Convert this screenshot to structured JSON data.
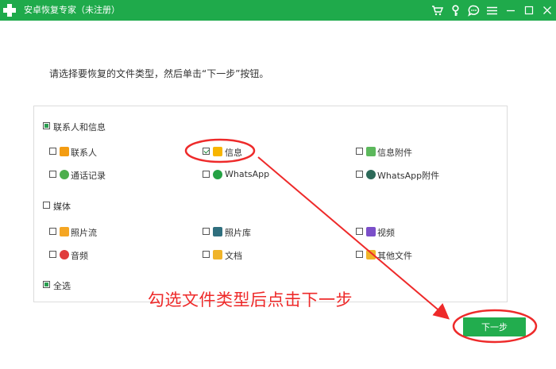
{
  "window": {
    "title": "安卓恢复专家（未注册）",
    "controls": [
      "cart-icon",
      "key-icon",
      "chat-icon",
      "menu-icon",
      "minimize-icon",
      "maximize-icon",
      "close-icon"
    ]
  },
  "instruction": "请选择要恢复的文件类型，然后单击“下一步”按钮。",
  "groups": {
    "contacts": {
      "label": "联系人和信息",
      "state": "partial",
      "items": [
        {
          "label": "联系人",
          "checked": false,
          "icon": "contacts-icon",
          "color": "#f39c12"
        },
        {
          "label": "信息",
          "checked": true,
          "icon": "message-icon",
          "color": "#f7b500"
        },
        {
          "label": "信息附件",
          "checked": false,
          "icon": "attachment-icon",
          "color": "#5cb85c"
        },
        {
          "label": "通话记录",
          "checked": false,
          "icon": "phone-icon",
          "color": "#4cae4c"
        },
        {
          "label": "WhatsApp",
          "checked": false,
          "icon": "whatsapp-icon",
          "color": "#25a244"
        },
        {
          "label": "WhatsApp附件",
          "checked": false,
          "icon": "whatsapp-attachment-icon",
          "color": "#2e6b5a"
        }
      ]
    },
    "media": {
      "label": "媒体",
      "state": "unchecked",
      "items": [
        {
          "label": "照片流",
          "checked": false,
          "icon": "photo-stream-icon",
          "color": "#f5a623"
        },
        {
          "label": "照片库",
          "checked": false,
          "icon": "photo-library-icon",
          "color": "#2f6f7e"
        },
        {
          "label": "视频",
          "checked": false,
          "icon": "video-icon",
          "color": "#7b4fc9"
        },
        {
          "label": "音频",
          "checked": false,
          "icon": "audio-icon",
          "color": "#e03b3b"
        },
        {
          "label": "文档",
          "checked": false,
          "icon": "document-icon",
          "color": "#f0b429"
        },
        {
          "label": "其他文件",
          "checked": false,
          "icon": "other-files-icon",
          "color": "#f0b429"
        }
      ]
    },
    "select_all": {
      "label": "全选",
      "state": "partial"
    }
  },
  "annotation": {
    "text": "勾选文件类型后点击下一步",
    "color": "#ee2a2a"
  },
  "next_button": {
    "label": "下一步",
    "color": "#22ad4e"
  },
  "colors": {
    "titlebar": "#1faa4b",
    "accent": "#22ad4e"
  }
}
